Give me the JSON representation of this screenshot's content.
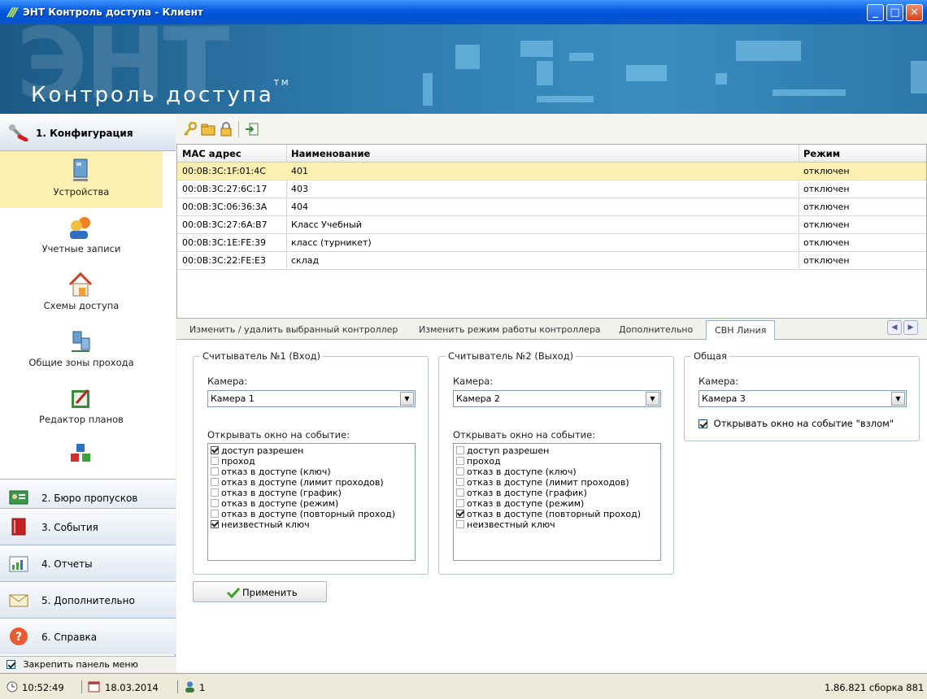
{
  "window": {
    "title": "ЭНТ Контроль доступа - Клиент"
  },
  "banner": {
    "logo": "Контроль доступа",
    "tm": "TM",
    "bg_text": "ЭНТ"
  },
  "nav": {
    "header": "1. Конфигурация",
    "items": [
      {
        "label": "Устройства",
        "icon": "computer-icon"
      },
      {
        "label": "Учетные записи",
        "icon": "users-icon"
      },
      {
        "label": "Схемы доступа",
        "icon": "house-icon"
      },
      {
        "label": "Общие зоны прохода",
        "icon": "network-icon"
      },
      {
        "label": "Редактор планов",
        "icon": "plan-editor-icon"
      },
      {
        "label": "",
        "icon": "cubes-icon"
      }
    ],
    "sections": [
      {
        "label": "2. Бюро пропусков",
        "icon": "id-card-icon"
      },
      {
        "label": "3. События",
        "icon": "book-icon"
      },
      {
        "label": "4. Отчеты",
        "icon": "chart-icon"
      },
      {
        "label": "5. Дополнительно",
        "icon": "envelope-icon"
      },
      {
        "label": "6. Справка",
        "icon": "help-icon"
      }
    ],
    "pin_label": "Закрепить панель меню"
  },
  "grid": {
    "columns": [
      "MAC адрес",
      "Наименование",
      "Режим"
    ],
    "rows": [
      {
        "mac": "00:0B:3C:1F:01:4C",
        "name": "401",
        "mode": "отключен"
      },
      {
        "mac": "00:0B:3C:27:6C:17",
        "name": "403",
        "mode": "отключен"
      },
      {
        "mac": "00:0B:3C:06:36:3A",
        "name": "404",
        "mode": "отключен"
      },
      {
        "mac": "00:0B:3C:27:6A:B7",
        "name": "Класс Учебный",
        "mode": "отключен"
      },
      {
        "mac": "00:0B:3C:1E:FE:39",
        "name": "класс (турникет)",
        "mode": "отключен"
      },
      {
        "mac": "00:0B:3C:22:FE:E3",
        "name": "склад",
        "mode": "отключен"
      }
    ]
  },
  "tabs": [
    "Изменить / удалить выбранный контроллер",
    "Изменить режим работы контроллера",
    "Дополнительно",
    "СВН Линия"
  ],
  "reader1": {
    "title": "Считыватель №1 (Вход)",
    "camera_label": "Камера:",
    "camera": "Камера 1",
    "events_label": "Открывать окно на событие:",
    "events": [
      {
        "label": "доступ разрешен",
        "checked": true
      },
      {
        "label": "проход",
        "checked": false
      },
      {
        "label": "отказ в доступе (ключ)",
        "checked": false
      },
      {
        "label": "отказ в доступе (лимит проходов)",
        "checked": false
      },
      {
        "label": "отказ в доступе (график)",
        "checked": false
      },
      {
        "label": "отказ в доступе (режим)",
        "checked": false
      },
      {
        "label": "отказ в доступе (повторный проход)",
        "checked": false
      },
      {
        "label": "неизвестный ключ",
        "checked": true
      }
    ]
  },
  "reader2": {
    "title": "Считыватель №2 (Выход)",
    "camera_label": "Камера:",
    "camera": "Камера 2",
    "events_label": "Открывать окно на событие:",
    "events": [
      {
        "label": "доступ разрешен",
        "checked": false
      },
      {
        "label": "проход",
        "checked": false
      },
      {
        "label": "отказ в доступе (ключ)",
        "checked": false
      },
      {
        "label": "отказ в доступе (лимит проходов)",
        "checked": false
      },
      {
        "label": "отказ в доступе (график)",
        "checked": false
      },
      {
        "label": "отказ в доступе (режим)",
        "checked": false
      },
      {
        "label": "отказ в доступе (повторный проход)",
        "checked": true
      },
      {
        "label": "неизвестный ключ",
        "checked": false
      }
    ]
  },
  "common": {
    "title": "Общая",
    "camera_label": "Камера:",
    "camera": "Камера 3",
    "breakin_label": "Открывать окно на событие \"взлом\"",
    "breakin_checked": true
  },
  "apply_label": "Применить",
  "status": {
    "time": "10:52:49",
    "date": "18.03.2014",
    "users": "1",
    "version": "1.86.821 сборка 881"
  },
  "colors": {
    "selection": "#fbf0b0",
    "title_bar": "#0a5ee0",
    "banner": "#2f7caf"
  }
}
